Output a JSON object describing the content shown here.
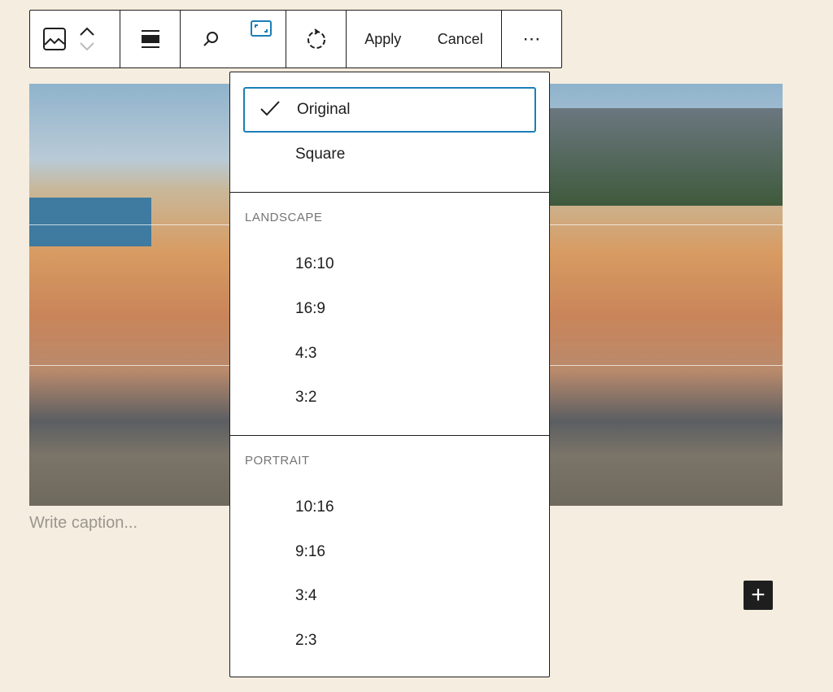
{
  "toolbar": {
    "apply": "Apply",
    "cancel": "Cancel",
    "more": "⋯",
    "icons": [
      "image-icon",
      "chevron-up-icon",
      "chevron-down-icon",
      "align-icon",
      "zoom-icon",
      "aspect-ratio-icon",
      "rotate-icon"
    ],
    "accent": "#1a7fb8"
  },
  "image": {
    "caption_placeholder": "Write caption..."
  },
  "add_block": "+",
  "aspect_menu": {
    "top_items": [
      {
        "label": "Original",
        "selected": true
      },
      {
        "label": "Square",
        "selected": false
      }
    ],
    "landscape": {
      "label": "LANDSCAPE",
      "items": [
        "16:10",
        "16:9",
        "4:3",
        "3:2"
      ]
    },
    "portrait": {
      "label": "PORTRAIT",
      "items": [
        "10:16",
        "9:16",
        "3:4",
        "2:3"
      ]
    }
  }
}
